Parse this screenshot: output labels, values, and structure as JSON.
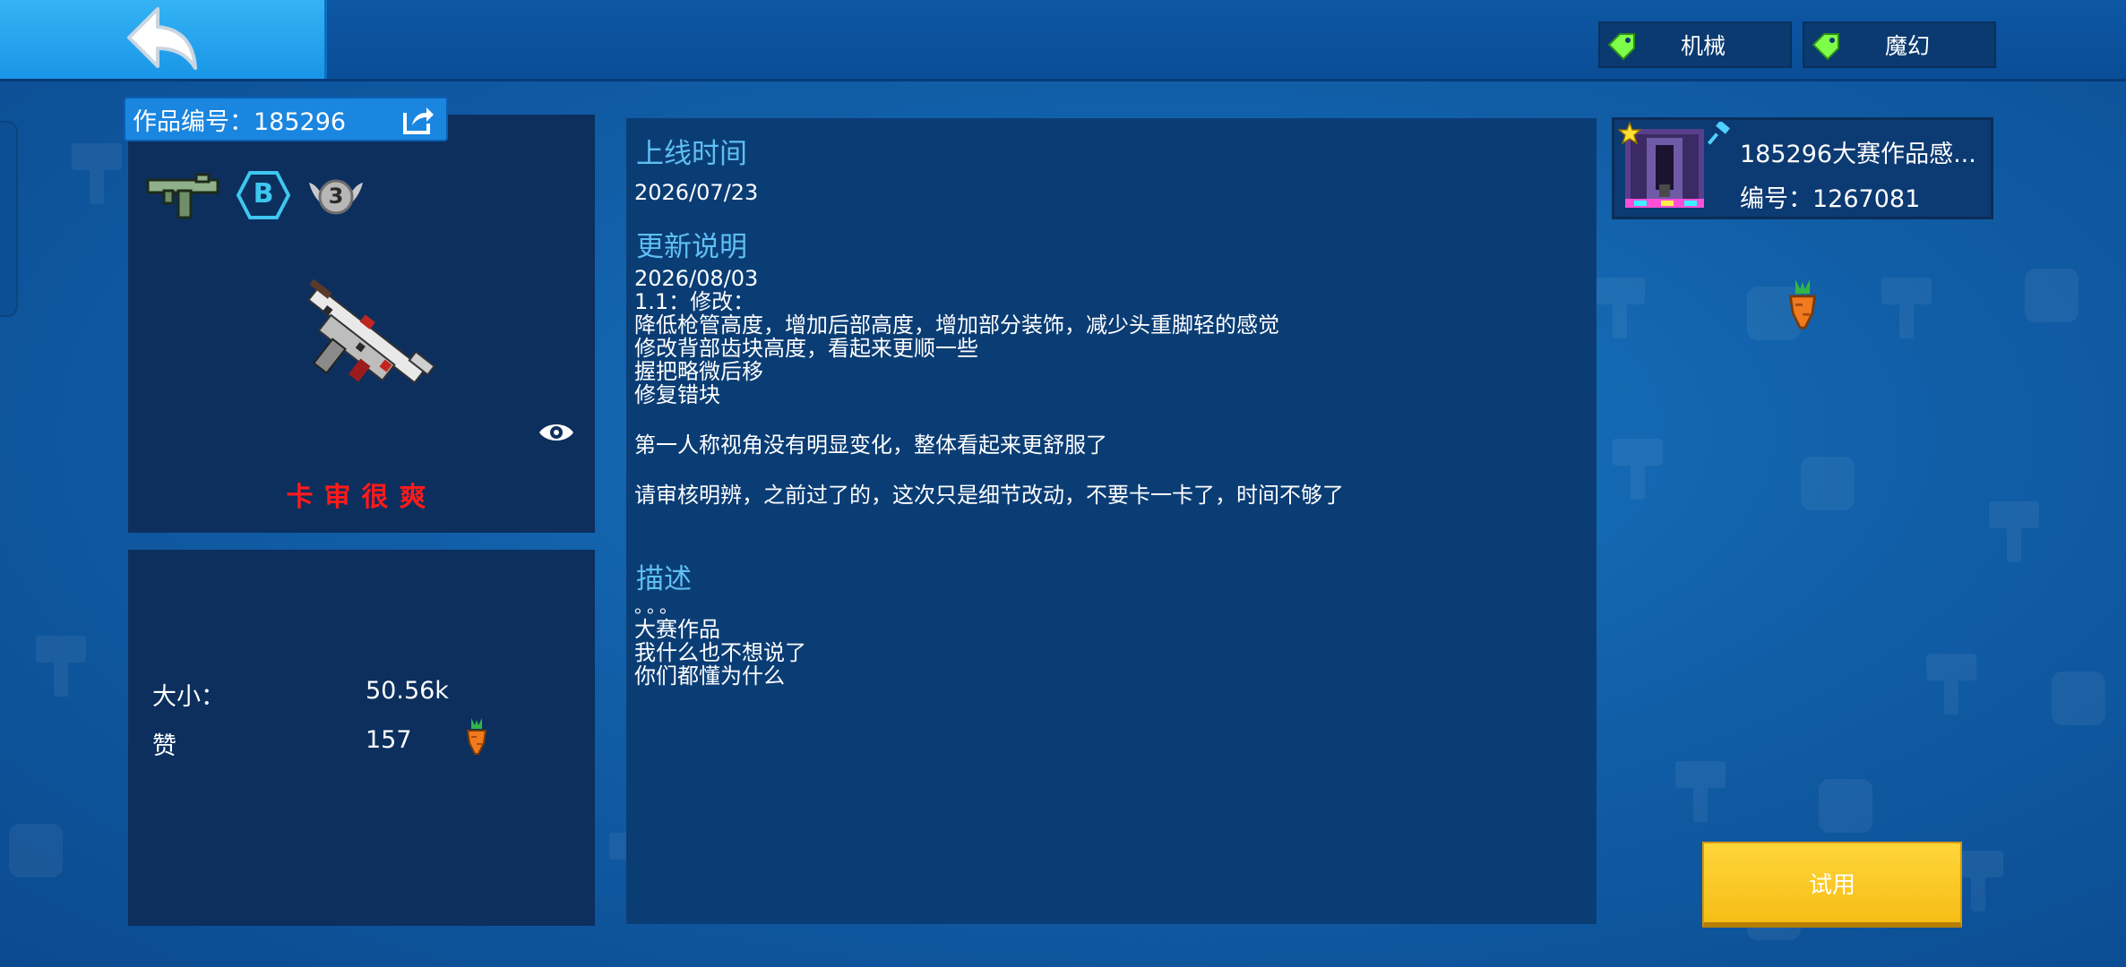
{
  "topbar": {
    "tags": [
      {
        "label": "机械",
        "icon": "price-tag-icon",
        "color": "#7dff4a"
      },
      {
        "label": "魔幻",
        "icon": "price-tag-icon",
        "color": "#7dff4a"
      }
    ]
  },
  "item": {
    "id_label": "作品编号：185296",
    "grade_badge": "B",
    "level_badge": "3",
    "name": "卡审很爽",
    "name_color": "#ff1a1a"
  },
  "stats": {
    "size_label": "大小：",
    "size_value": "50.56k",
    "likes_label": "赞",
    "likes_value": "157"
  },
  "details": {
    "online_title": "上线时间",
    "online_date": "2026/07/23",
    "update_title": "更新说明",
    "update_notes": [
      "2026/08/03",
      "1.1：修改：",
      "降低枪管高度，增加后部高度，增加部分装饰，减少头重脚轻的感觉",
      "修改背部齿块高度，看起来更顺一些",
      "握把略微后移",
      "修复错块",
      "第一人称视角没有明显变化，整体看起来更舒服了",
      "请审核明辨，之前过了的，这次只是细节改动，不要卡一卡了，时间不够了"
    ],
    "desc_title": "描述",
    "desc_lines": [
      "。。。",
      "大赛作品",
      "我什么也不想说了",
      "你们都懂为什么"
    ]
  },
  "reference": {
    "title": "185296大赛作品感...",
    "id_label": "编号：1267081"
  },
  "actions": {
    "try_label": "试用"
  },
  "colors": {
    "accent_blue": "#5fbff2",
    "try_button": "#f9c623",
    "panel": "#0c2f5e"
  }
}
